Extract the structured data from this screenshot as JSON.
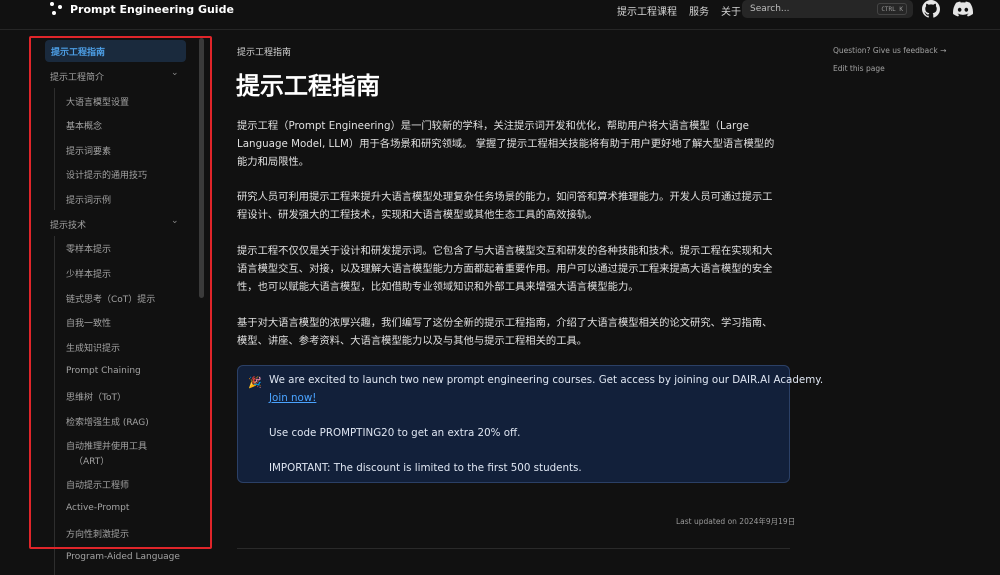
{
  "header": {
    "logo_text": "Prompt Engineering Guide",
    "nav": [
      "提示工程课程",
      "服务",
      "关于"
    ],
    "search_placeholder": "Search...",
    "search_shortcut": "CTRL K",
    "github_icon": "github-icon",
    "discord_icon": "discord-icon"
  },
  "sidebar": {
    "active": "提示工程指南",
    "sections": [
      {
        "label": "提示工程简介",
        "items": [
          "大语言模型设置",
          "基本概念",
          "提示词要素",
          "设计提示的通用技巧",
          "提示词示例"
        ]
      },
      {
        "label": "提示技术",
        "items": [
          "零样本提示",
          "少样本提示",
          "链式思考（CoT）提示",
          "自我一致性",
          "生成知识提示",
          "Prompt Chaining",
          "思维树（ToT）",
          "检索增强生成 (RAG)",
          "自动推理并使用工具",
          "（ART）",
          "自动提示工程师",
          "Active-Prompt",
          "方向性刺激提示",
          "Program-Aided Language"
        ]
      }
    ]
  },
  "main": {
    "breadcrumb": "提示工程指南",
    "title": "提示工程指南",
    "paragraphs": [
      [
        "提示工程（Prompt Engineering）是一门较新的学科，关注提示词开发和优化，帮助用户将大语言模型（Large",
        "Language Model, LLM）用于各场景和研究领域。 掌握了提示工程相关技能将有助于用户更好地了解大型语言模型的",
        "能力和局限性。"
      ],
      [
        "研究人员可利用提示工程来提升大语言模型处理复杂任务场景的能力，如问答和算术推理能力。开发人员可通过提示工",
        "程设计、研发强大的工程技术，实现和大语言模型或其他生态工具的高效接轨。"
      ],
      [
        "提示工程不仅仅是关于设计和研发提示词。它包含了与大语言模型交互和研发的各种技能和技术。提示工程在实现和大",
        "语言模型交互、对接，以及理解大语言模型能力方面都起着重要作用。用户可以通过提示工程来提高大语言模型的安全",
        "性，也可以赋能大语言模型，比如借助专业领域知识和外部工具来增强大语言模型能力。"
      ],
      [
        "基于对大语言模型的浓厚兴趣，我们编写了这份全新的提示工程指南，介绍了大语言模型相关的论文研究、学习指南、",
        "模型、讲座、参考资料、大语言模型能力以及与其他与提示工程相关的工具。"
      ]
    ],
    "callout": {
      "emoji": "🎉",
      "line1": "We are excited to launch two new prompt engineering courses. Get access by joining our DAIR.AI Academy.",
      "link": "Join now!",
      "line2": "Use code PROMPTING20 to get an extra 20% off.",
      "line3": "IMPORTANT: The discount is limited to the first 500 students."
    },
    "last_updated": "Last updated on 2024年9月19日"
  },
  "toc": {
    "feedback": "Question? Give us feedback →",
    "edit": "Edit this page"
  },
  "colors": {
    "background": "#111111",
    "accent": "#4d9fe6",
    "highlight_box": "#e0252a",
    "callout_bg": "#12203a"
  }
}
